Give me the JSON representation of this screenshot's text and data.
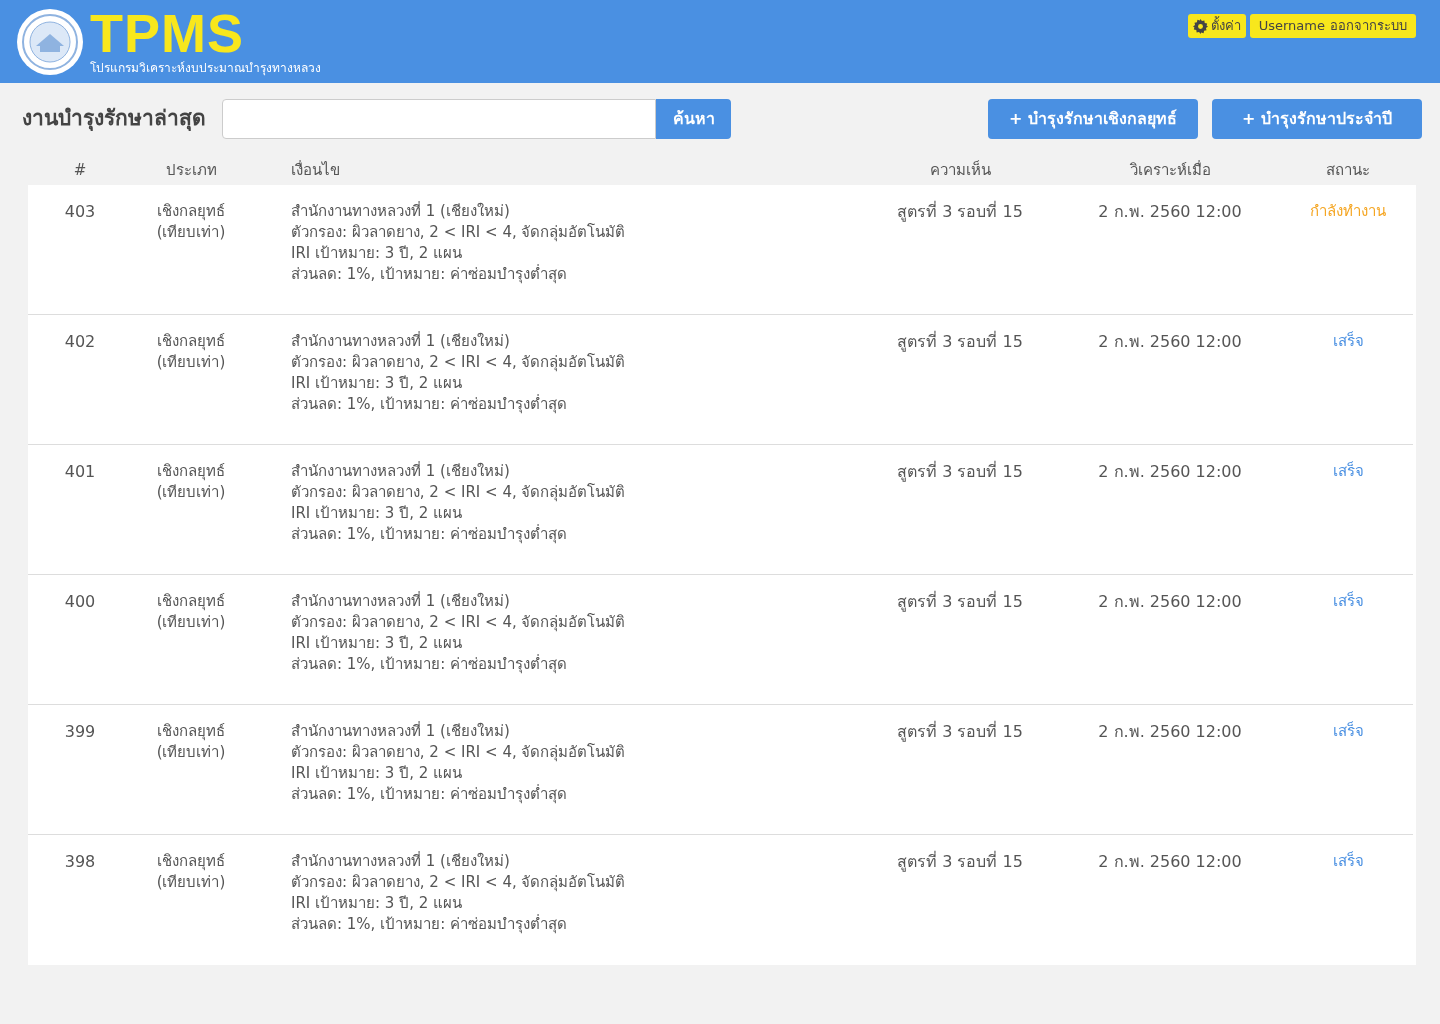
{
  "header": {
    "logo_text": "TPMS",
    "subtitle": "โปรแกรมวิเคราะห์งบประมาณบำรุงทางหลวง",
    "settings_button": "ตั้งค่า",
    "username": "Username",
    "logout_button": "ออกจากระบบ"
  },
  "toolbar": {
    "title": "งานบำรุงรักษาล่าสุด",
    "search_button": "ค้นหา",
    "buttons": [
      "+ บำรุงรักษาเชิงกลยุทธ์",
      "+ บำรุงรักษาประจำปี"
    ]
  },
  "table": {
    "columns": [
      "#",
      "ประเภท",
      "เงื่อนไข",
      "ความเห็น",
      "วิเคราะห์เมื่อ",
      "สถานะ"
    ],
    "rows": [
      {
        "id": "403",
        "type": [
          "เชิงกลยุทธ์",
          "(เทียบเท่า)"
        ],
        "condition": [
          "สำนักงานทางหลวงที่ 1 (เชียงใหม่)",
          "ตัวกรอง: ผิวลาดยาง, 2 < IRI < 4, จัดกลุ่มอัตโนมัติ",
          "IRI เป้าหมาย: 3 ปี, 2 แผน",
          "ส่วนลด: 1%, เป้าหมาย: ค่าซ่อมบำรุงต่ำสุด"
        ],
        "comment": "สูตรที่ 3 รอบที่ 15",
        "analyzed": "2 ก.พ. 2560 12:00",
        "status": "กำลังทำงาน",
        "color": "#f5a623"
      },
      {
        "id": "402",
        "type": [
          "เชิงกลยุทธ์",
          "(เทียบเท่า)"
        ],
        "condition": [
          "สำนักงานทางหลวงที่ 1 (เชียงใหม่)",
          "ตัวกรอง: ผิวลาดยาง, 2 < IRI < 4, จัดกลุ่มอัตโนมัติ",
          "IRI เป้าหมาย: 3 ปี, 2 แผน",
          "ส่วนลด: 1%, เป้าหมาย: ค่าซ่อมบำรุงต่ำสุด"
        ],
        "comment": "สูตรที่ 3 รอบที่ 15",
        "analyzed": "2 ก.พ. 2560 12:00",
        "status": "เสร็จ",
        "color": "#4a90e2"
      },
      {
        "id": "401",
        "type": [
          "เชิงกลยุทธ์",
          "(เทียบเท่า)"
        ],
        "condition": [
          "สำนักงานทางหลวงที่ 1 (เชียงใหม่)",
          "ตัวกรอง: ผิวลาดยาง, 2 < IRI < 4, จัดกลุ่มอัตโนมัติ",
          "IRI เป้าหมาย: 3 ปี, 2 แผน",
          "ส่วนลด: 1%, เป้าหมาย: ค่าซ่อมบำรุงต่ำสุด"
        ],
        "comment": "สูตรที่ 3 รอบที่ 15",
        "analyzed": "2 ก.พ. 2560 12:00",
        "status": "เสร็จ",
        "color": "#4a90e2"
      },
      {
        "id": "400",
        "type": [
          "เชิงกลยุทธ์",
          "(เทียบเท่า)"
        ],
        "condition": [
          "สำนักงานทางหลวงที่ 1 (เชียงใหม่)",
          "ตัวกรอง: ผิวลาดยาง, 2 < IRI < 4, จัดกลุ่มอัตโนมัติ",
          "IRI เป้าหมาย: 3 ปี, 2 แผน",
          "ส่วนลด: 1%, เป้าหมาย: ค่าซ่อมบำรุงต่ำสุด"
        ],
        "comment": "สูตรที่ 3 รอบที่ 15",
        "analyzed": "2 ก.พ. 2560 12:00",
        "status": "เสร็จ",
        "color": "#4a90e2"
      },
      {
        "id": "399",
        "type": [
          "เชิงกลยุทธ์",
          "(เทียบเท่า)"
        ],
        "condition": [
          "สำนักงานทางหลวงที่ 1 (เชียงใหม่)",
          "ตัวกรอง: ผิวลาดยาง, 2 < IRI < 4, จัดกลุ่มอัตโนมัติ",
          "IRI เป้าหมาย: 3 ปี, 2 แผน",
          "ส่วนลด: 1%, เป้าหมาย: ค่าซ่อมบำรุงต่ำสุด"
        ],
        "comment": "สูตรที่ 3 รอบที่ 15",
        "analyzed": "2 ก.พ. 2560 12:00",
        "status": "เสร็จ",
        "color": "#4a90e2"
      },
      {
        "id": "398",
        "type": [
          "เชิงกลยุทธ์",
          "(เทียบเท่า)"
        ],
        "condition": [
          "สำนักงานทางหลวงที่ 1 (เชียงใหม่)",
          "ตัวกรอง: ผิวลาดยาง, 2 < IRI < 4, จัดกลุ่มอัตโนมัติ",
          "IRI เป้าหมาย: 3 ปี, 2 แผน",
          "ส่วนลด: 1%, เป้าหมาย: ค่าซ่อมบำรุงต่ำสุด"
        ],
        "comment": "สูตรที่ 3 รอบที่ 15",
        "analyzed": "2 ก.พ. 2560 12:00",
        "status": "เสร็จ",
        "color": "#4a90e2"
      }
    ]
  }
}
